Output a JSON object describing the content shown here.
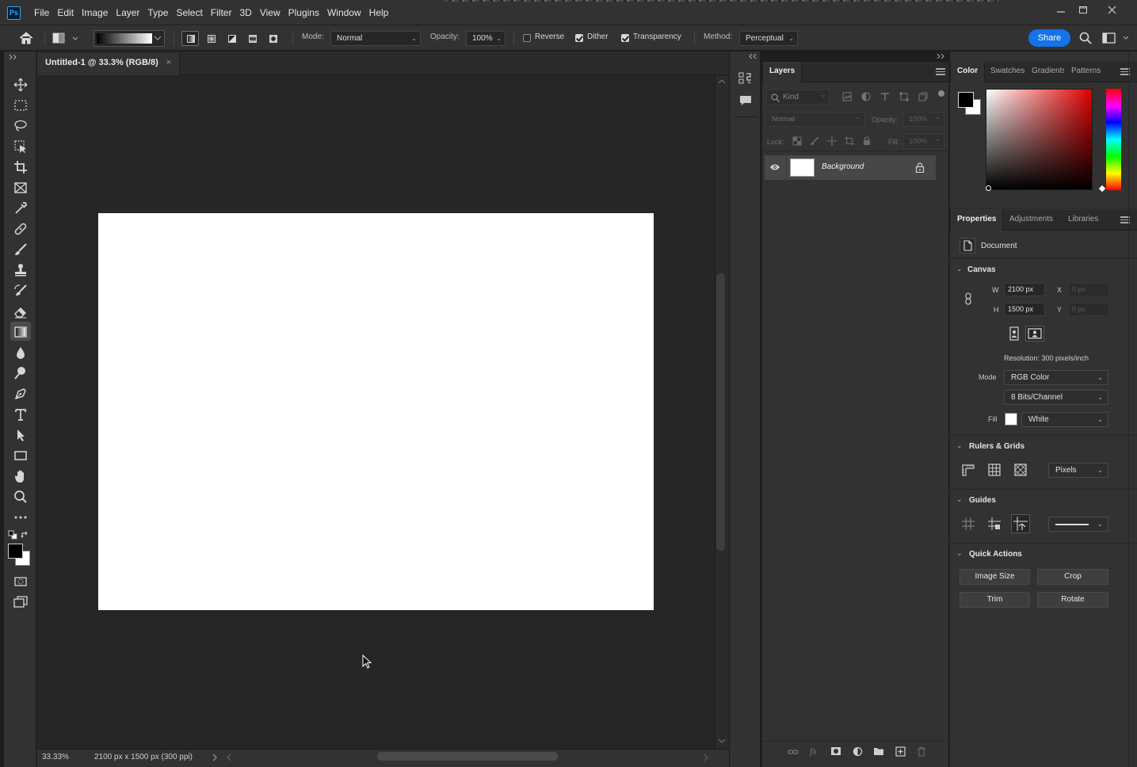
{
  "menubar": {
    "logo": "Ps",
    "items": [
      "File",
      "Edit",
      "Image",
      "Layer",
      "Type",
      "Select",
      "Filter",
      "3D",
      "View",
      "Plugins",
      "Window",
      "Help"
    ]
  },
  "options": {
    "mode_label": "Mode:",
    "mode_value": "Normal",
    "opacity_label": "Opacity:",
    "opacity_value": "100%",
    "reverse_label": "Reverse",
    "reverse_checked": false,
    "dither_label": "Dither",
    "dither_checked": true,
    "transparency_label": "Transparency",
    "transparency_checked": true,
    "method_label": "Method:",
    "method_value": "Perceptual",
    "share_label": "Share"
  },
  "document": {
    "tab_title": "Untitled-1 @ 33.3% (RGB/8)",
    "close_glyph": "×",
    "zoom": "33.33%",
    "info": "2100 px x 1500 px (300 ppi)"
  },
  "layers_panel": {
    "tab": "Layers",
    "filter_placeholder": "Kind",
    "blend_mode": "Normal",
    "opacity_label": "Opacity:",
    "opacity_value": "100%",
    "lock_label": "Lock:",
    "fill_label": "Fill:",
    "fill_value": "100%",
    "layers": [
      {
        "name": "Background",
        "visible": true,
        "locked": true
      }
    ]
  },
  "color_panel": {
    "tabs": [
      "Color",
      "Swatches",
      "Gradients",
      "Patterns"
    ],
    "foreground": "#000000",
    "background": "#ffffff",
    "hue_color": "#e00000"
  },
  "properties_panel": {
    "tabs": [
      "Properties",
      "Adjustments",
      "Libraries"
    ],
    "doc_label": "Document",
    "canvas": {
      "title": "Canvas",
      "w_label": "W",
      "w_value": "2100 px",
      "h_label": "H",
      "h_value": "1500 px",
      "x_label": "X",
      "x_value": "0 px",
      "y_label": "Y",
      "y_value": "0 px",
      "resolution": "Resolution: 300 pixels/inch",
      "mode_label": "Mode",
      "mode_value": "RGB Color",
      "depth_value": "8 Bits/Channel",
      "fill_label": "Fill",
      "fill_value": "White"
    },
    "rulers": {
      "title": "Rulers & Grids",
      "units": "Pixels"
    },
    "guides": {
      "title": "Guides"
    },
    "quick_actions": {
      "title": "Quick Actions",
      "buttons": [
        "Image Size",
        "Crop",
        "Trim",
        "Rotate"
      ]
    }
  }
}
